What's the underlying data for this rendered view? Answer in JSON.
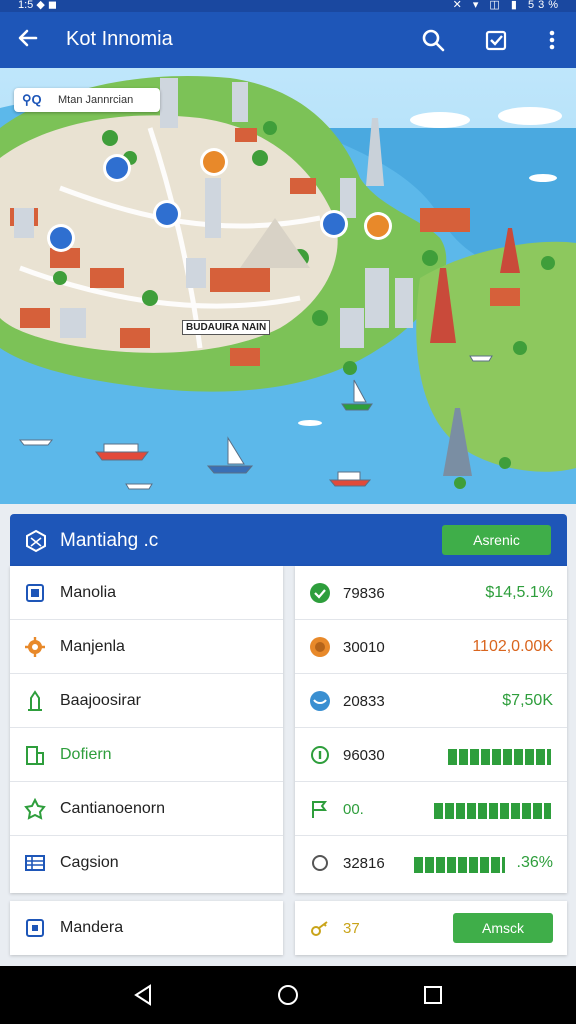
{
  "status_bar": {
    "left_text": "1:5 ◆ ◼",
    "right_text": "✕ ▾ ◫ ▮ 53%"
  },
  "app_bar": {
    "title": "Kot Innomia",
    "back_icon": "arrow-left-icon",
    "actions": [
      "search-icon",
      "checkbox-icon",
      "more-vert-icon"
    ]
  },
  "map": {
    "search_text": "Mtan Jannrcian",
    "label": "BUDAUIRA NAIN"
  },
  "panel": {
    "title": "Mantiahg .c",
    "button": "Asrenic"
  },
  "left_list": [
    {
      "label": "Manolia",
      "icon": "square-icon",
      "color": "#1e56b8"
    },
    {
      "label": "Manjenla",
      "icon": "gear-icon",
      "color": "#e8892a"
    },
    {
      "label": "Baajoosirar",
      "icon": "monument-icon",
      "color": "#2e9e3c"
    },
    {
      "label": "Dofiern",
      "icon": "building-icon",
      "color": "#2e9e3c"
    },
    {
      "label": "Cantianoenorn",
      "icon": "star-icon",
      "color": "#2e9e3c"
    },
    {
      "label": "Cagsion",
      "icon": "table-icon",
      "color": "#1e56b8"
    }
  ],
  "right_list": [
    {
      "num": "79836",
      "value": "$14,5.1%",
      "icon": "shield-icon",
      "color": "#2e9e3c"
    },
    {
      "num": "30010",
      "value": "1102,0.00K",
      "icon": "coin-icon",
      "color": "#e8892a"
    },
    {
      "num": "20833",
      "value": "$7,50K",
      "icon": "globe-icon",
      "color": "#3a8fd1"
    },
    {
      "num": "96030",
      "value": "",
      "icon": "info-icon",
      "color": "#2e9e3c",
      "bar_fraction": 0.82
    },
    {
      "num": "00.",
      "value": "",
      "icon": "flag-icon",
      "color": "#2e9e3c",
      "bar_fraction": 0.93
    },
    {
      "num": "32816",
      "value": ".36%",
      "icon": "circle-icon",
      "color": "#666666",
      "bar_fraction": 0.72
    }
  ],
  "bottom_left": {
    "label": "Mandera",
    "icon": "square-icon"
  },
  "bottom_right": {
    "num": "37",
    "button": "Amsck",
    "icon": "key-icon"
  },
  "nav": {
    "icons": [
      "back-triangle-icon",
      "home-circle-icon",
      "recents-square-icon"
    ]
  },
  "colors": {
    "primary": "#1e56b8",
    "accent": "#3fae49",
    "orange": "#e8892a"
  }
}
